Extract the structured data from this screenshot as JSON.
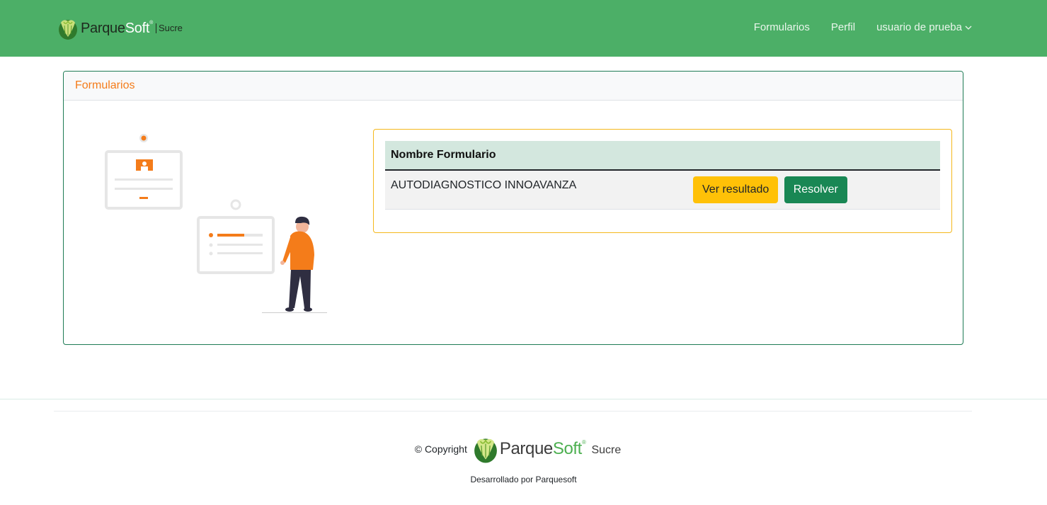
{
  "navbar": {
    "brand": {
      "name_part1": "Parque",
      "name_part2": "Soft",
      "registered": "®",
      "sub": "Sucre"
    },
    "links": [
      {
        "label": "Formularios"
      },
      {
        "label": "Perfil"
      },
      {
        "label": "usuario de prueba"
      }
    ],
    "bg_color": "#4caf67"
  },
  "card": {
    "title": "Formularios",
    "table": {
      "headers": [
        "Nombre Formulario",
        ""
      ],
      "rows": [
        {
          "name": "AUTODIAGNOSTICO INNOAVANZA",
          "actions": [
            "Ver resultado",
            "Resolver"
          ]
        }
      ]
    }
  },
  "footer": {
    "copyright": "© Copyright",
    "brand": {
      "name_part1": "Parque",
      "name_part2": "Soft",
      "registered": "®",
      "sub": "Sucre"
    },
    "developed_by": "Desarrollado por Parquesoft"
  },
  "colors": {
    "accent_orange": "#f47c1a",
    "btn_warning": "#ffc107",
    "btn_success": "#198754",
    "card_border": "#1e7b55"
  },
  "icons": [
    "parquesoft-logo-icon",
    "chevron-down-icon",
    "forms-illustration"
  ]
}
